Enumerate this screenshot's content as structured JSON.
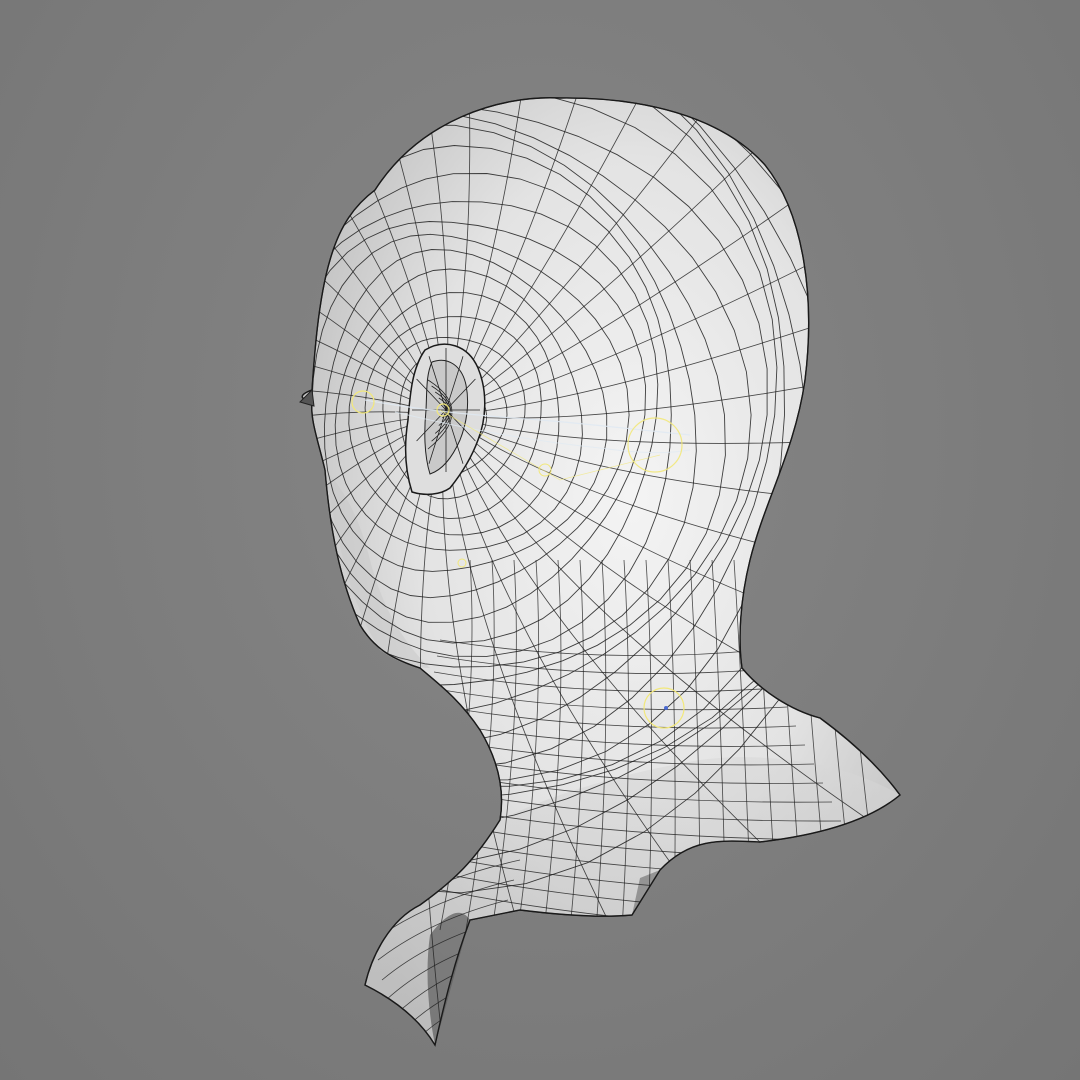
{
  "viewport": {
    "background_color": "#7b7b7b",
    "mesh_fill_color": "#e6e6e6",
    "mesh_wire_color": "#1e1e1e",
    "rig_locator_color": "#f2e87a",
    "rig_curve_color": "#dfe9f2"
  },
  "model": {
    "subject": "head-and-neck-quad-mesh",
    "view": "rear-three-quarter",
    "display_mode": "smooth-shaded-with-wireframe"
  }
}
